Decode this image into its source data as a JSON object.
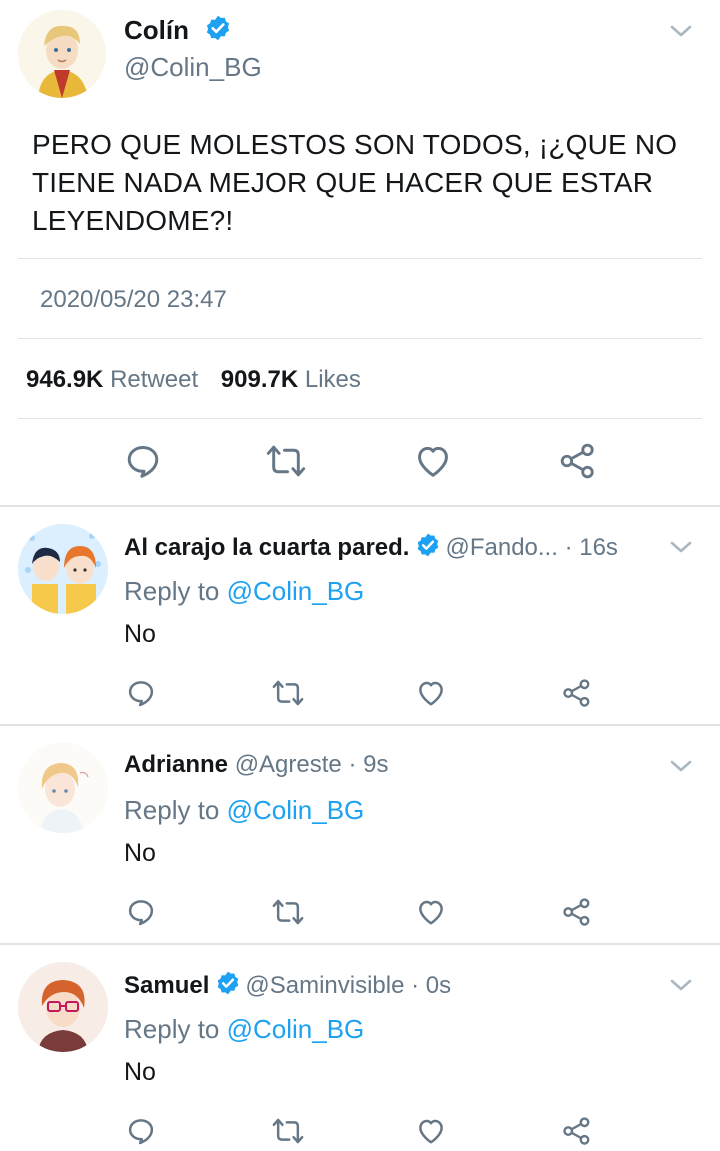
{
  "main_tweet": {
    "name": "Colín",
    "handle": "@Colin_BG",
    "text": "PERO QUE MOLESTOS SON TODOS, ¡¿QUE NO TIENE NADA MEJOR QUE HACER QUE ESTAR LEYENDOME?!",
    "timestamp": "2020/05/20 23:47",
    "retweets_count": "946.9K",
    "retweets_label": "Retweet",
    "likes_count": "909.7K",
    "likes_label": "Likes"
  },
  "replies": [
    {
      "name": "Al carajo la cuarta pared.",
      "verified": true,
      "handle": "@Fando...",
      "time": "· 16s",
      "reply_prefix": "Reply to ",
      "reply_to": "@Colin_BG",
      "text": "No"
    },
    {
      "name": "Adrianne",
      "verified": false,
      "handle": "@Agreste",
      "time": "· 9s",
      "reply_prefix": "Reply to ",
      "reply_to": "@Colin_BG",
      "text": "No"
    },
    {
      "name": "Samuel",
      "verified": true,
      "handle": "@Saminvisible",
      "time": "· 0s",
      "reply_prefix": "Reply to ",
      "reply_to": "@Colin_BG",
      "text": "No"
    }
  ],
  "icons": {
    "reply": "reply-icon",
    "retweet": "retweet-icon",
    "like": "heart-icon",
    "share": "share-icon",
    "verified": "verified-badge-icon",
    "menu": "chevron-down-icon"
  },
  "colors": {
    "text": "#14171a",
    "secondary": "#657786",
    "accent": "#1da1f2",
    "divider": "#e1e4e7"
  }
}
